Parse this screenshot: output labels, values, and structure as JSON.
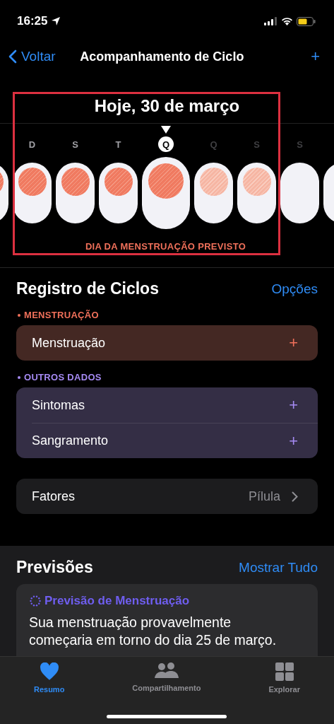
{
  "status_bar": {
    "time": "16:25"
  },
  "nav": {
    "back": "Voltar",
    "title": "Acompanhamento de Ciclo",
    "action": "+"
  },
  "calendar": {
    "date_title": "Hoje, 30 de março",
    "legend": "DIA DA MENSTRUAÇÃO PREVISTO",
    "days": [
      {
        "kind": "period",
        "selected": false
      },
      {
        "letter": "D",
        "kind": "period",
        "selected": false,
        "future": false
      },
      {
        "letter": "S",
        "kind": "period",
        "selected": false,
        "future": false
      },
      {
        "letter": "T",
        "kind": "period",
        "selected": false,
        "future": false
      },
      {
        "letter": "Q",
        "kind": "period",
        "selected": true,
        "future": false
      },
      {
        "letter": "Q",
        "kind": "predicted",
        "selected": false,
        "future": true
      },
      {
        "letter": "S",
        "kind": "predicted",
        "selected": false,
        "future": true
      },
      {
        "letter": "S",
        "kind": "none",
        "selected": false,
        "future": true
      },
      {
        "kind": "none",
        "selected": false
      }
    ]
  },
  "cycle_log": {
    "title": "Registro de Ciclos",
    "options": "Opções",
    "groups": [
      {
        "header": "MENSTRUAÇÃO",
        "color": "#f0705a",
        "items": [
          {
            "label": "Menstruação",
            "action": "+"
          }
        ]
      },
      {
        "header": "OUTROS DADOS",
        "color": "#a58af2",
        "items": [
          {
            "label": "Sintomas",
            "action": "+"
          },
          {
            "label": "Sangramento",
            "action": "+"
          }
        ]
      }
    ],
    "factors": {
      "label": "Fatores",
      "value": "Pílula"
    }
  },
  "predictions": {
    "title": "Previsões",
    "show_all": "Mostrar Tudo",
    "card": {
      "title": "Previsão de Menstruação",
      "body": "Sua menstruação provavelmente começaria em torno do dia 25 de março."
    }
  },
  "tab_bar": [
    {
      "label": "Resumo",
      "kind": "heart",
      "selected": true
    },
    {
      "label": "Compartilhamento",
      "kind": "people",
      "selected": false
    },
    {
      "label": "Explorar",
      "kind": "grid",
      "selected": false
    }
  ]
}
